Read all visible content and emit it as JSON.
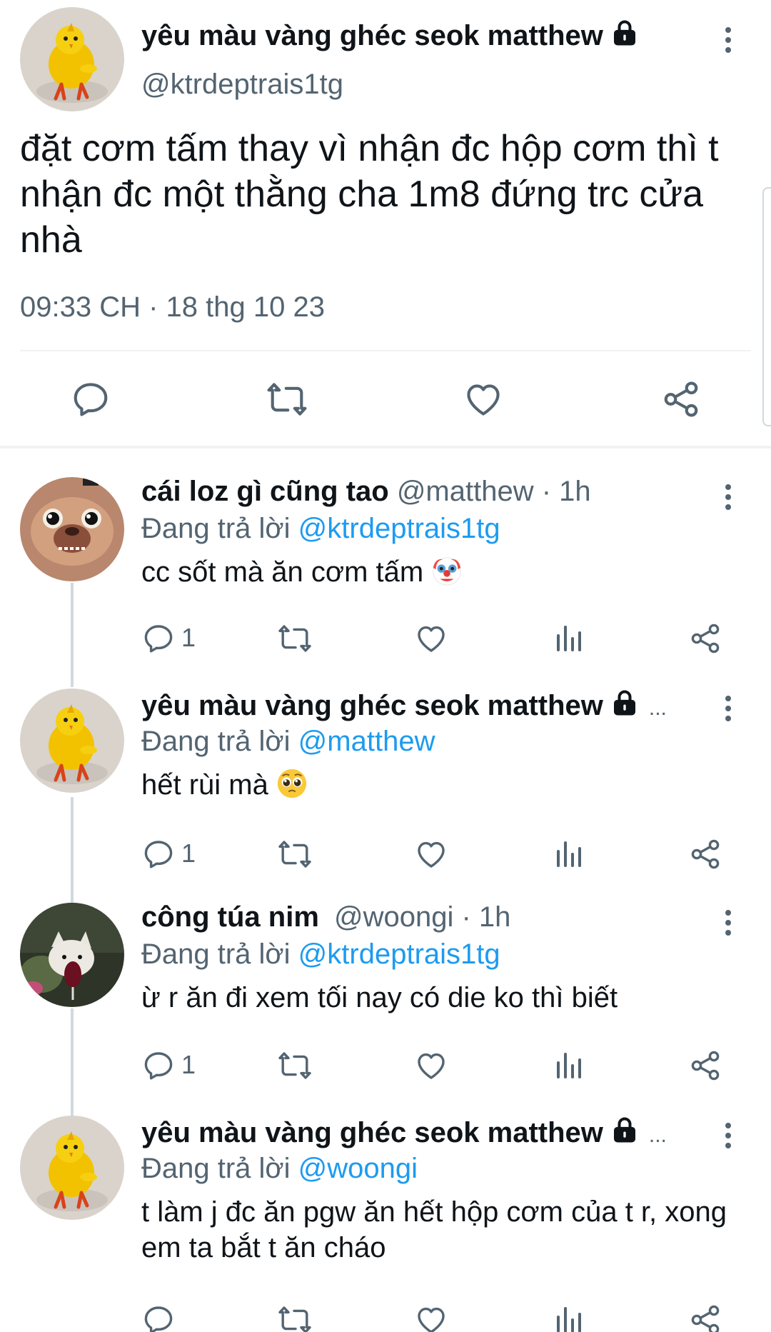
{
  "main_tweet": {
    "display_name": "yêu màu vàng ghéc seok matthew",
    "handle": "@ktrdeptrais1tg",
    "text": "đặt cơm tấm thay vì nhận đc hộp cơm thì t nhận đc một thằng cha 1m8 đứng trc cửa nhà",
    "timestamp": "09:33 CH · 18 thg 10 23"
  },
  "replies": [
    {
      "display_name": "cái loz gì cũng tao",
      "meta": "@matthew · 1h",
      "replying_prefix": "Đang trả lời",
      "replying_to": "@ktrdeptrais1tg",
      "text": "cc sốt mà ăn cơm tấm",
      "emoji": "clown-face-emoji",
      "reply_count": "1"
    },
    {
      "display_name": "yêu màu vàng ghéc seok matthew",
      "meta": "...",
      "replying_prefix": "Đang trả lời",
      "replying_to": "@matthew",
      "text": "hết rùi mà",
      "emoji": "pleading-face-emoji",
      "reply_count": "1"
    },
    {
      "display_name": "công túa nim",
      "meta": "@woongi · 1h",
      "replying_prefix": "Đang trả lời",
      "replying_to": "@ktrdeptrais1tg",
      "text": "ừ r ăn đi xem tối nay có die ko thì biết",
      "emoji": "",
      "reply_count": "1"
    },
    {
      "display_name": "yêu màu vàng ghéc seok matthew",
      "meta": "...",
      "replying_prefix": "Đang trả lời",
      "replying_to": "@woongi",
      "text": "t làm j đc ăn pgw ăn hết hộp cơm của t r, xong em ta bắt t ăn cháo",
      "emoji": "",
      "reply_count": ""
    }
  ],
  "colors": {
    "text_primary": "#0f1419",
    "text_secondary": "#536471",
    "accent": "#1d9bf0",
    "divider": "#eff3f4"
  }
}
